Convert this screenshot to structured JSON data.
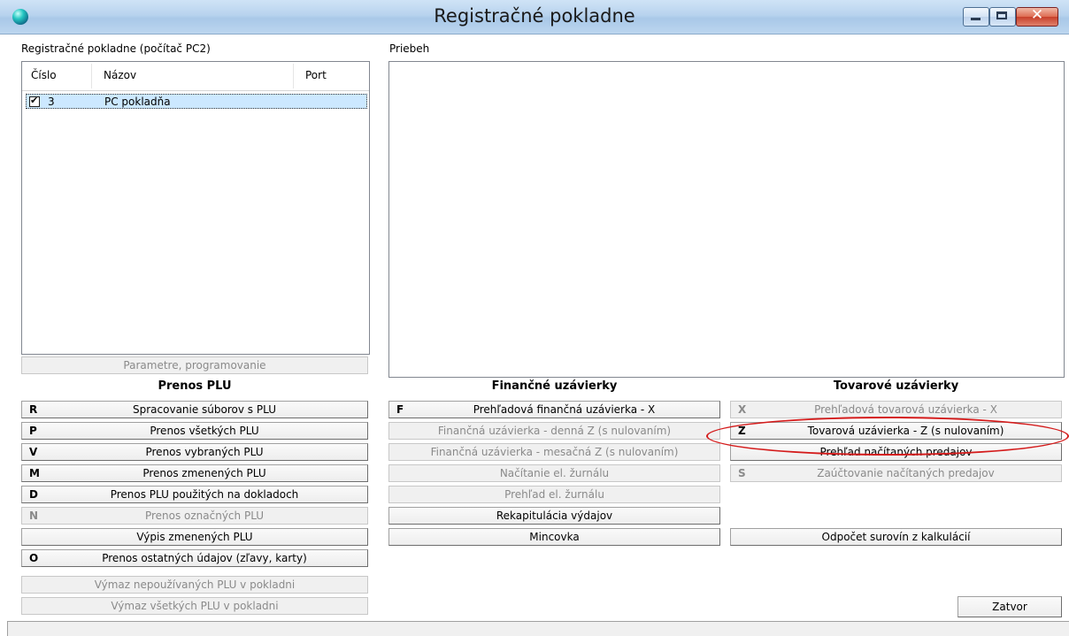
{
  "window": {
    "title": "Registračné pokladne"
  },
  "registers": {
    "label": "Registračné pokladne (počítač PC2)",
    "columns": [
      "Číslo",
      "Názov",
      "Port"
    ],
    "rows": [
      {
        "checked": true,
        "number": "3",
        "name": "PC pokladňa",
        "port": ""
      }
    ],
    "params_button": "Parametre, programovanie"
  },
  "progress": {
    "label": "Priebeh"
  },
  "plu": {
    "heading": "Prenos PLU",
    "buttons": [
      {
        "key": "R",
        "label": "Spracovanie súborov s PLU",
        "enabled": true
      },
      {
        "key": "P",
        "label": "Prenos všetkých PLU",
        "enabled": true
      },
      {
        "key": "V",
        "label": "Prenos vybraných PLU",
        "enabled": true
      },
      {
        "key": "M",
        "label": "Prenos zmenených PLU",
        "enabled": true
      },
      {
        "key": "D",
        "label": "Prenos PLU použitých na dokladoch",
        "enabled": true
      },
      {
        "key": "N",
        "label": "Prenos označných PLU",
        "enabled": false
      },
      {
        "key": "",
        "label": "Výpis zmenených PLU",
        "enabled": true
      },
      {
        "key": "O",
        "label": "Prenos ostatných údajov (zľavy, karty)",
        "enabled": true
      }
    ],
    "delete_unused": "Výmaz nepoužívaných PLU v pokladni",
    "delete_all": "Výmaz všetkých PLU v pokladni"
  },
  "financial": {
    "heading": "Finančné uzávierky",
    "buttons": [
      {
        "key": "F",
        "label": "Prehľadová finančná uzávierka - X",
        "enabled": true
      },
      {
        "key": "",
        "label": "Finančná uzávierka - denná Z (s nulovaním)",
        "enabled": false
      },
      {
        "key": "",
        "label": "Finančná uzávierka - mesačná Z (s nulovaním)",
        "enabled": false
      },
      {
        "key": "",
        "label": "Načítanie el. žurnálu",
        "enabled": false
      },
      {
        "key": "",
        "label": "Prehľad el. žurnálu",
        "enabled": false
      },
      {
        "key": "",
        "label": "Rekapitulácia výdajov",
        "enabled": true
      },
      {
        "key": "",
        "label": "Mincovka",
        "enabled": true
      }
    ]
  },
  "goods": {
    "heading": "Tovarové uzávierky",
    "buttons": [
      {
        "key": "X",
        "label": "Prehľadová tovarová uzávierka - X",
        "enabled": false
      },
      {
        "key": "Z",
        "label": "Tovarová uzávierka - Z (s nulovaním)",
        "enabled": true
      },
      {
        "key": "",
        "label": "Prehľad načítaných predajov",
        "enabled": true
      },
      {
        "key": "S",
        "label": "Zaúčtovanie načítaných predajov",
        "enabled": false
      }
    ],
    "ingredients_button": "Odpočet surovín z kalkulácií"
  },
  "close_button": "Zatvor",
  "colors": {
    "annotation": "#d41b1b",
    "selection": "#cce8ff"
  }
}
